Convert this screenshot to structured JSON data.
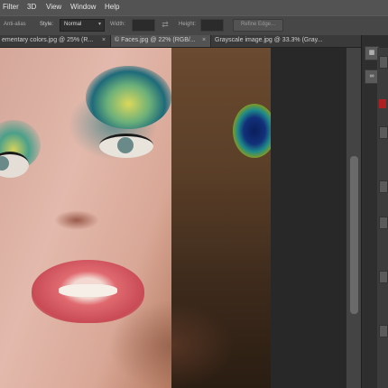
{
  "menu": {
    "items": [
      "Filter",
      "3D",
      "View",
      "Window",
      "Help"
    ]
  },
  "options_bar": {
    "anti_alias_label": "Anti-alias",
    "style_label": "Style:",
    "style_value": "Normal",
    "width_label": "Width:",
    "height_label": "Height:",
    "refine_edge_label": "Refine Edge..."
  },
  "tabs": [
    {
      "label": "ementary colors.jpg @ 25% (R...",
      "close": "×",
      "active": false
    },
    {
      "label": "© Faces.jpg @ 22% (RGB/...",
      "close": "×",
      "active": true
    },
    {
      "label": "Grayscale image.jpg @ 33.3% (Gray...",
      "close": "×",
      "active": false
    }
  ],
  "icons": {
    "swap": "swap-arrows-icon",
    "chevron": "chevron-down-icon"
  },
  "colors": {
    "menubar": "#535353",
    "options_bar": "#474747",
    "workspace": "#282828",
    "panel": "#2e2e2e"
  }
}
